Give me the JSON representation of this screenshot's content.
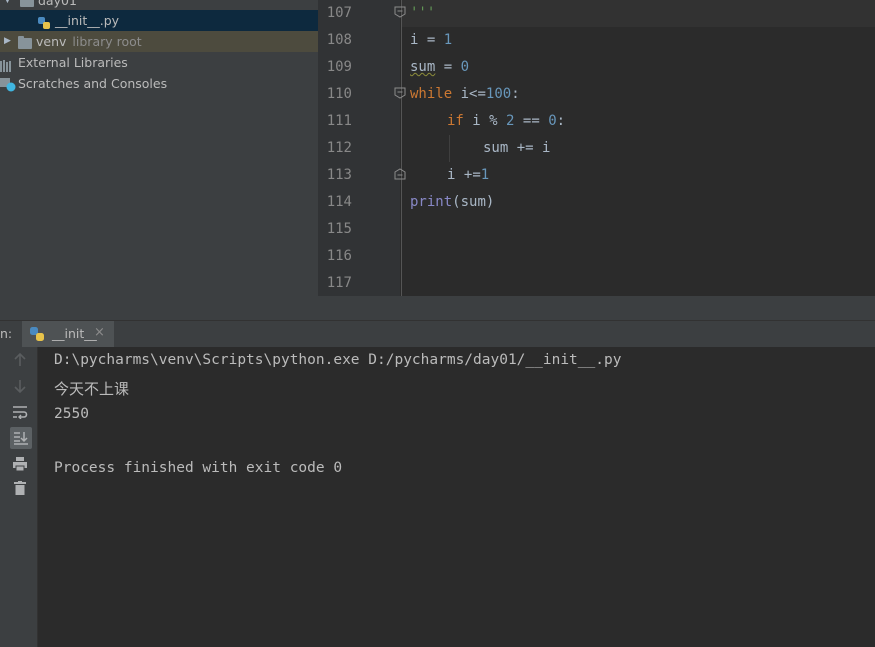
{
  "project_tree": {
    "items": [
      {
        "label": "day01",
        "type": "folder"
      },
      {
        "label": "__init__.py",
        "type": "python-file"
      },
      {
        "label": "venv",
        "sublabel": "library root",
        "type": "folder"
      },
      {
        "label": "External Libraries",
        "type": "libraries"
      },
      {
        "label": "Scratches and Consoles",
        "type": "scratches"
      }
    ]
  },
  "editor": {
    "lines": [
      {
        "number": "107",
        "text": "'''"
      },
      {
        "number": "108",
        "text": "i = 1"
      },
      {
        "number": "109",
        "text": "sum = 0"
      },
      {
        "number": "110",
        "text": "while i<=100:"
      },
      {
        "number": "111",
        "text": "if i % 2 == 0:"
      },
      {
        "number": "112",
        "text": "sum += i"
      },
      {
        "number": "113",
        "text": "i +=1"
      },
      {
        "number": "114",
        "text": "print(sum)"
      },
      {
        "number": "115",
        "text": ""
      },
      {
        "number": "116",
        "text": ""
      },
      {
        "number": "117",
        "text": ""
      }
    ]
  },
  "run_panel": {
    "prefix": "n:",
    "tab_label": "__init__",
    "close_glyph": "×",
    "toolbar": [
      "up-arrow-icon",
      "down-arrow-icon",
      "soft-wrap-icon",
      "scroll-to-end-icon",
      "print-icon",
      "trash-icon"
    ],
    "console_lines": [
      "D:\\pycharms\\venv\\Scripts\\python.exe D:/pycharms/day01/__init__.py",
      "今天不上课",
      "2550",
      "",
      "Process finished with exit code 0"
    ]
  },
  "colors": {
    "keyword": "#cc7832",
    "number": "#6897bb",
    "string": "#629755",
    "builtin": "#8888c6",
    "background": "#2b2b2b",
    "panel": "#3c3f41"
  }
}
